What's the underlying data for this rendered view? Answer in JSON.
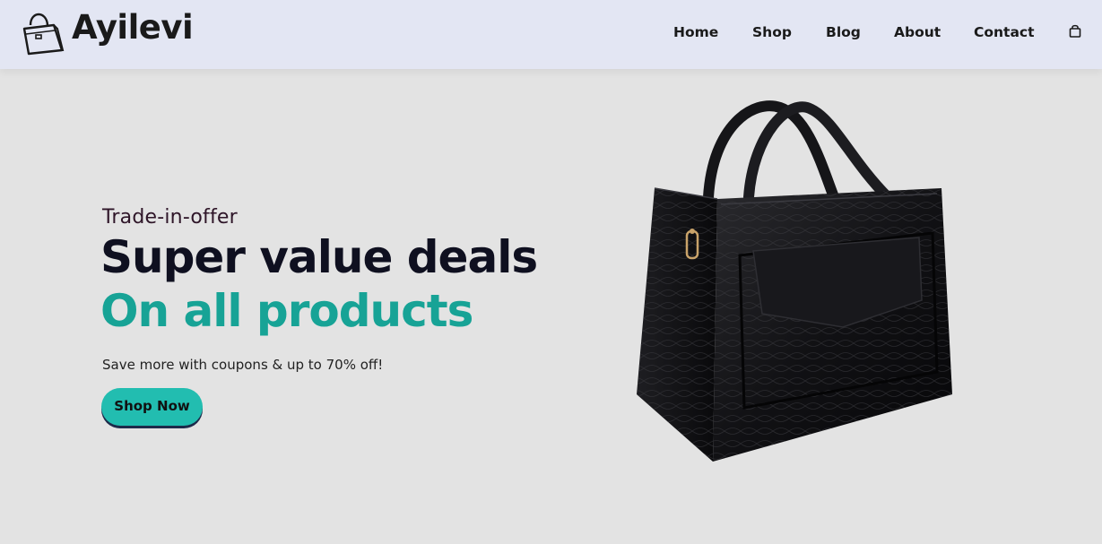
{
  "brand": {
    "name": "Ayilevi",
    "logo_icon": "handbag-logo-icon"
  },
  "nav": {
    "items": [
      {
        "label": "Home"
      },
      {
        "label": "Shop"
      },
      {
        "label": "Blog"
      },
      {
        "label": "About"
      },
      {
        "label": "Contact"
      }
    ],
    "cart_icon": "shopping-bag-icon"
  },
  "hero": {
    "subtitle": "Trade-in-offer",
    "title": "Super value deals",
    "accent_title": "On all products",
    "description": "Save more with coupons & up to 70% off!",
    "cta_label": "Shop Now",
    "product_image": "black-croc-leather-handbag"
  },
  "colors": {
    "header_bg": "#e3e6f3",
    "page_bg": "#e3e3e3",
    "accent": "#17a396",
    "button": "#22bdb0",
    "text_dark": "#0f1020"
  }
}
